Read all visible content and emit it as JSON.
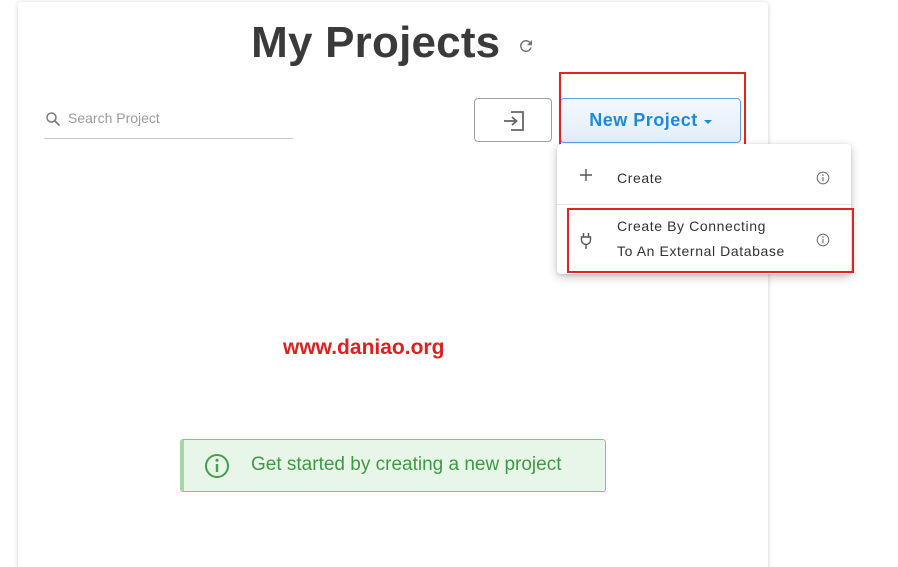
{
  "header": {
    "title": "My Projects",
    "refresh_icon": "refresh-icon"
  },
  "search": {
    "placeholder": "Search Project",
    "value": "",
    "icon": "search-icon"
  },
  "toolbar": {
    "import_icon": "sign-in-icon",
    "new_project_label": "New Project"
  },
  "new_project_menu": {
    "items": [
      {
        "icon": "plus-icon",
        "label": "Create",
        "info_icon": "info-icon"
      },
      {
        "icon": "plug-icon",
        "label_line1": "Create By Connecting",
        "label_line2": "To An External Database",
        "info_icon": "info-icon"
      }
    ]
  },
  "watermark": "www.daniao.org",
  "empty_state": {
    "message": "Get started by creating a new project",
    "icon": "info-circle-icon"
  },
  "colors": {
    "accent": "#1e88e5",
    "highlight": "#e02424",
    "success_bg": "#e8f5e9",
    "success_text": "#3f9a44",
    "watermark": "#e01f1f"
  }
}
